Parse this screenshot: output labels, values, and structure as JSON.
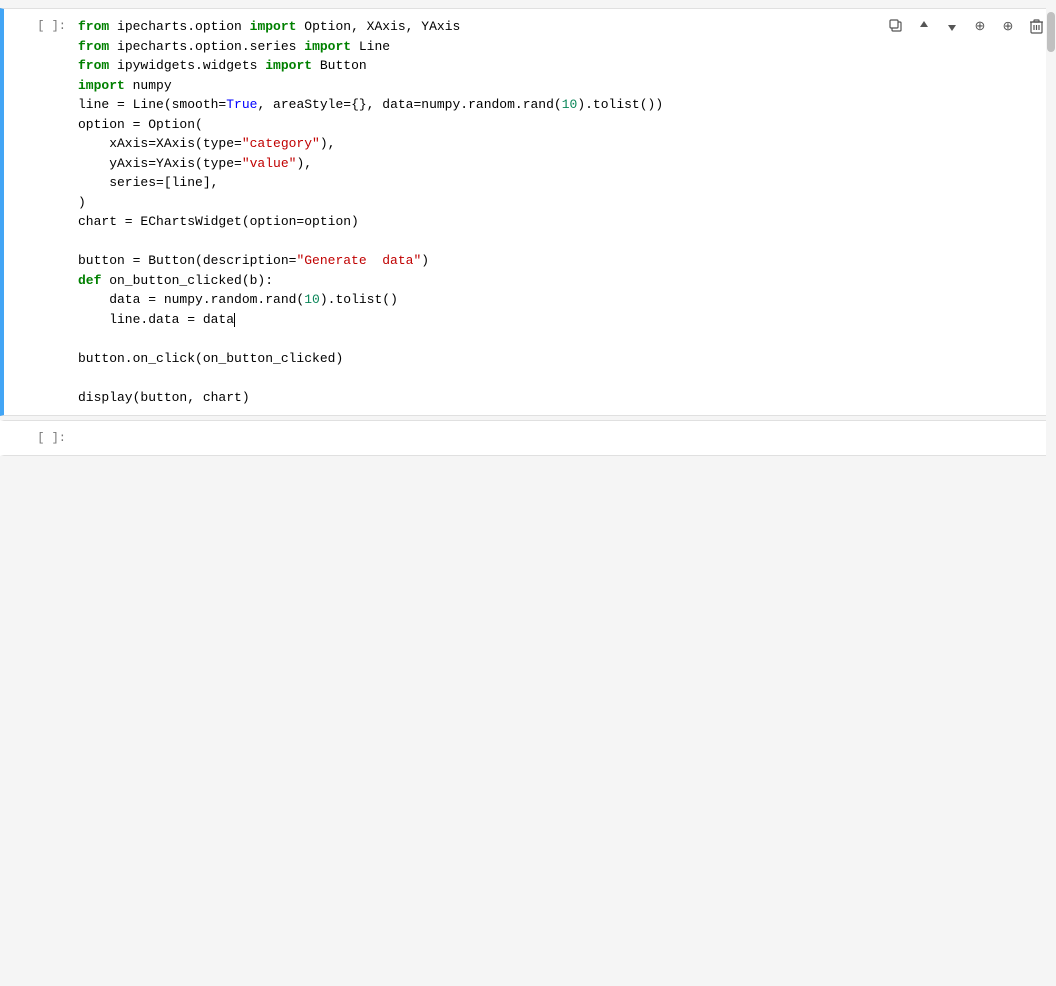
{
  "cells": [
    {
      "id": "cell-1",
      "prompt": "[ ]:",
      "active": true,
      "lines": [
        {
          "tokens": [
            {
              "type": "kw",
              "text": "from"
            },
            {
              "type": "plain",
              "text": " ipecharts.option "
            },
            {
              "type": "kw",
              "text": "import"
            },
            {
              "type": "plain",
              "text": " Option, XAxis, YAxis"
            }
          ]
        },
        {
          "tokens": [
            {
              "type": "kw",
              "text": "from"
            },
            {
              "type": "plain",
              "text": " ipecharts.option.series "
            },
            {
              "type": "kw",
              "text": "import"
            },
            {
              "type": "plain",
              "text": " Line"
            }
          ]
        },
        {
          "tokens": [
            {
              "type": "kw",
              "text": "from"
            },
            {
              "type": "plain",
              "text": " ipywidgets.widgets "
            },
            {
              "type": "kw",
              "text": "import"
            },
            {
              "type": "plain",
              "text": " Button"
            }
          ]
        },
        {
          "tokens": [
            {
              "type": "kw",
              "text": "import"
            },
            {
              "type": "plain",
              "text": " numpy"
            }
          ]
        },
        {
          "tokens": [
            {
              "type": "plain",
              "text": "line = Line(smooth="
            },
            {
              "type": "param-val",
              "text": "True"
            },
            {
              "type": "plain",
              "text": ", areaStyle="
            },
            {
              "type": "plain",
              "text": "{}, data=numpy.random.rand("
            },
            {
              "type": "num",
              "text": "10"
            },
            {
              "type": "plain",
              "text": ").tolist())"
            }
          ]
        },
        {
          "tokens": [
            {
              "type": "plain",
              "text": "option = Option("
            }
          ]
        },
        {
          "tokens": [
            {
              "type": "plain",
              "text": "    xAxis=XAxis(type="
            },
            {
              "type": "str",
              "text": "\"category\""
            },
            {
              "type": "plain",
              "text": "),"
            }
          ]
        },
        {
          "tokens": [
            {
              "type": "plain",
              "text": "    yAxis=YAxis(type="
            },
            {
              "type": "str",
              "text": "\"value\""
            },
            {
              "type": "plain",
              "text": "),"
            }
          ]
        },
        {
          "tokens": [
            {
              "type": "plain",
              "text": "    series=[line],"
            }
          ]
        },
        {
          "tokens": [
            {
              "type": "plain",
              "text": ")"
            }
          ]
        },
        {
          "tokens": [
            {
              "type": "plain",
              "text": "chart = EChartsWidget(option=option)"
            }
          ]
        },
        {
          "tokens": [
            {
              "type": "plain",
              "text": ""
            }
          ]
        },
        {
          "tokens": [
            {
              "type": "plain",
              "text": "button = Button(description="
            },
            {
              "type": "str",
              "text": "\"Generate  data\""
            },
            {
              "type": "plain",
              "text": ")"
            }
          ]
        },
        {
          "tokens": [
            {
              "type": "kw",
              "text": "def"
            },
            {
              "type": "plain",
              "text": " on_button_clicked(b):"
            }
          ]
        },
        {
          "tokens": [
            {
              "type": "plain",
              "text": "    data = numpy.random.rand("
            },
            {
              "type": "num",
              "text": "10"
            },
            {
              "type": "plain",
              "text": ").tolist()"
            }
          ]
        },
        {
          "tokens": [
            {
              "type": "plain",
              "text": "    line.data = data"
            },
            {
              "type": "cursor",
              "text": ""
            }
          ]
        },
        {
          "tokens": [
            {
              "type": "plain",
              "text": ""
            }
          ]
        },
        {
          "tokens": [
            {
              "type": "plain",
              "text": "button.on_click(on_button_clicked)"
            }
          ]
        },
        {
          "tokens": [
            {
              "type": "plain",
              "text": ""
            }
          ]
        },
        {
          "tokens": [
            {
              "type": "plain",
              "text": "display(button, chart)"
            }
          ]
        }
      ],
      "toolbar": {
        "buttons": [
          {
            "name": "copy-icon",
            "symbol": "⧉"
          },
          {
            "name": "move-up-icon",
            "symbol": "↑"
          },
          {
            "name": "move-down-icon",
            "symbol": "↓"
          },
          {
            "name": "insert-above-icon",
            "symbol": "⊕"
          },
          {
            "name": "insert-below-icon",
            "symbol": "⊕"
          },
          {
            "name": "delete-icon",
            "symbol": "🗑"
          }
        ]
      }
    },
    {
      "id": "cell-2",
      "prompt": "[ ]:",
      "active": false,
      "lines": [
        {
          "tokens": [
            {
              "type": "plain",
              "text": ""
            }
          ]
        }
      ],
      "toolbar": null
    }
  ]
}
